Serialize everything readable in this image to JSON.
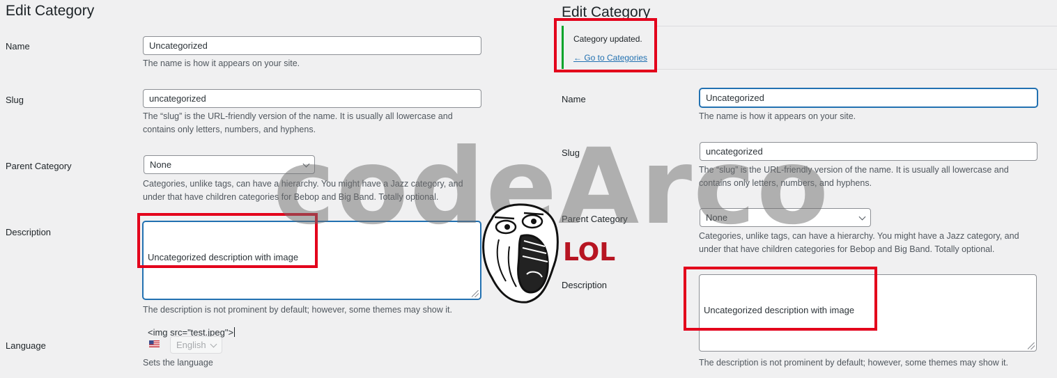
{
  "left": {
    "title": "Edit Category",
    "name_label": "Name",
    "name_value": "Uncategorized",
    "name_help": "The name is how it appears on your site.",
    "slug_label": "Slug",
    "slug_value": "uncategorized",
    "slug_help_1": "The “slug” is the URL-friendly version of the name. It is usually all lowercase and",
    "slug_help_2": "contains only letters, numbers, and hyphens.",
    "parent_label": "Parent Category",
    "parent_value": "None",
    "parent_help_1": "Categories, unlike tags, can have a hierarchy. You might have a Jazz category, and",
    "parent_help_2": "under that have children categories for Bebop and Big Band. Totally optional.",
    "desc_label": "Description",
    "desc_line_1": "Uncategorized description with image",
    "desc_line_2": "<img src=\"test.jpeg\">",
    "desc_help": "The description is not prominent by default; however, some themes may show it.",
    "language_label": "Language",
    "language_value": "English",
    "language_help": "Sets the language"
  },
  "right": {
    "title": "Edit Category",
    "notice_text": "Category updated.",
    "notice_link": "← Go to Categories",
    "name_label": "Name",
    "name_value": "Uncategorized",
    "name_help": "The name is how it appears on your site.",
    "slug_label": "Slug",
    "slug_value": "uncategorized",
    "slug_help_1": "The “slug” is the URL-friendly version of the name. It is usually all lowercase and",
    "slug_help_2": "contains only letters, numbers, and hyphens.",
    "parent_label": "Parent Category",
    "parent_value": "None",
    "parent_help_1": "Categories, unlike tags, can have a hierarchy. You might have a Jazz category, and",
    "parent_help_2": "under that have children categories for Bebop and Big Band. Totally optional.",
    "desc_label": "Description",
    "desc_value": "Uncategorized description with image",
    "desc_help": "The description is not prominent by default; however, some themes may show it."
  },
  "overlay": {
    "watermark": "codeArco",
    "lol": "LOL",
    "meme_icon": "troll-face-icon",
    "highlight_color": "#e3001b",
    "success_color": "#00a32a",
    "link_color": "#2271b1"
  }
}
